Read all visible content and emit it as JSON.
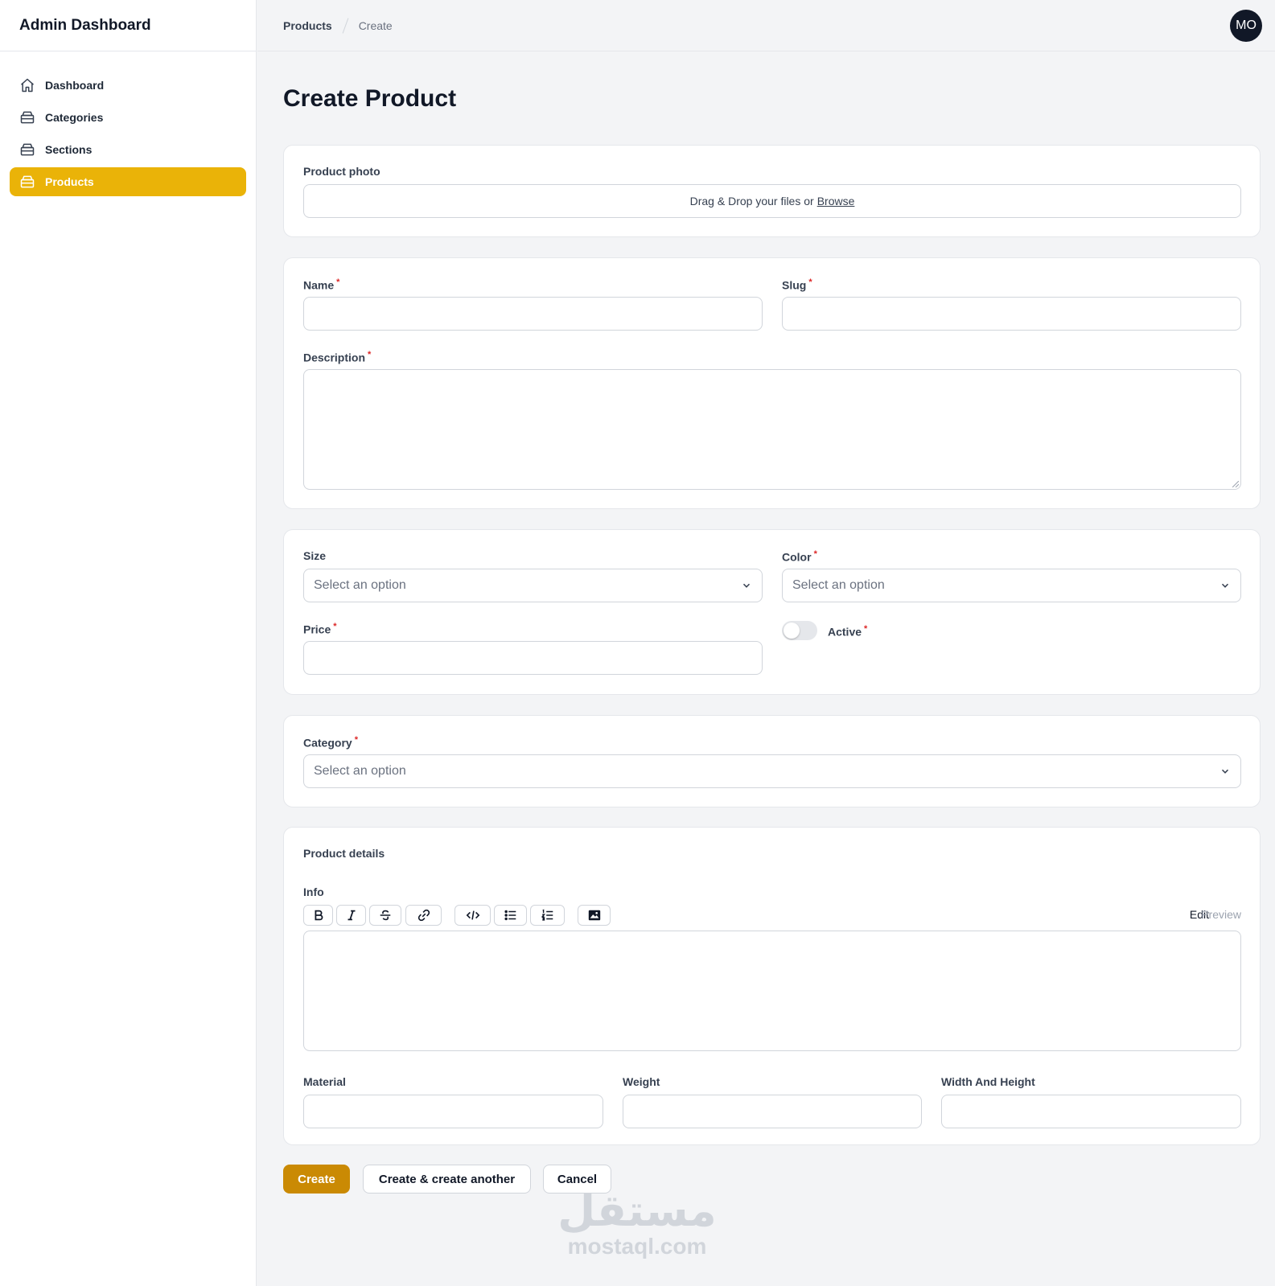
{
  "sidebar": {
    "brand": "Admin Dashboard",
    "items": [
      {
        "label": "Dashboard",
        "icon": "home-icon"
      },
      {
        "label": "Categories",
        "icon": "archive-box-icon"
      },
      {
        "label": "Sections",
        "icon": "archive-box-icon"
      },
      {
        "label": "Products",
        "icon": "archive-box-icon",
        "active": true
      }
    ]
  },
  "topbar": {
    "breadcrumbs": [
      "Products",
      "Create"
    ],
    "avatar_initials": "MO"
  },
  "page": {
    "title": "Create Product"
  },
  "photo_section": {
    "label": "Product photo",
    "dropzone_text": "Drag & Drop your files or",
    "browse_link": "Browse"
  },
  "basic_section": {
    "name_label": "Name",
    "slug_label": "Slug",
    "description_label": "Description",
    "required_mark": "*"
  },
  "attributes_section": {
    "size_label": "Size",
    "size_placeholder": "Select an option",
    "color_label": "Color",
    "color_placeholder": "Select an option",
    "price_label": "Price",
    "active_label": "Active",
    "active_value": false
  },
  "category_section": {
    "category_label": "Category",
    "category_placeholder": "Select an option"
  },
  "details_section": {
    "heading": "Product details",
    "info_label": "Info",
    "editor_tabs": {
      "edit": "Edit",
      "preview": "Preview"
    },
    "toolbar_icons": [
      "bold-icon",
      "italic-icon",
      "strikethrough-icon",
      "link-icon",
      "code-icon",
      "bullet-list-icon",
      "ordered-list-icon",
      "image-icon"
    ],
    "material_label": "Material",
    "weight_label": "Weight",
    "width_height_label": "Width And Height"
  },
  "actions": {
    "create": "Create",
    "create_another": "Create & create another",
    "cancel": "Cancel"
  },
  "watermark": {
    "arabic": "مستقل",
    "latin": "mostaql.com"
  },
  "colors": {
    "accent": "#eab308",
    "primary_button": "#ca8a04",
    "required": "#dc2626",
    "avatar_bg": "#111827"
  }
}
